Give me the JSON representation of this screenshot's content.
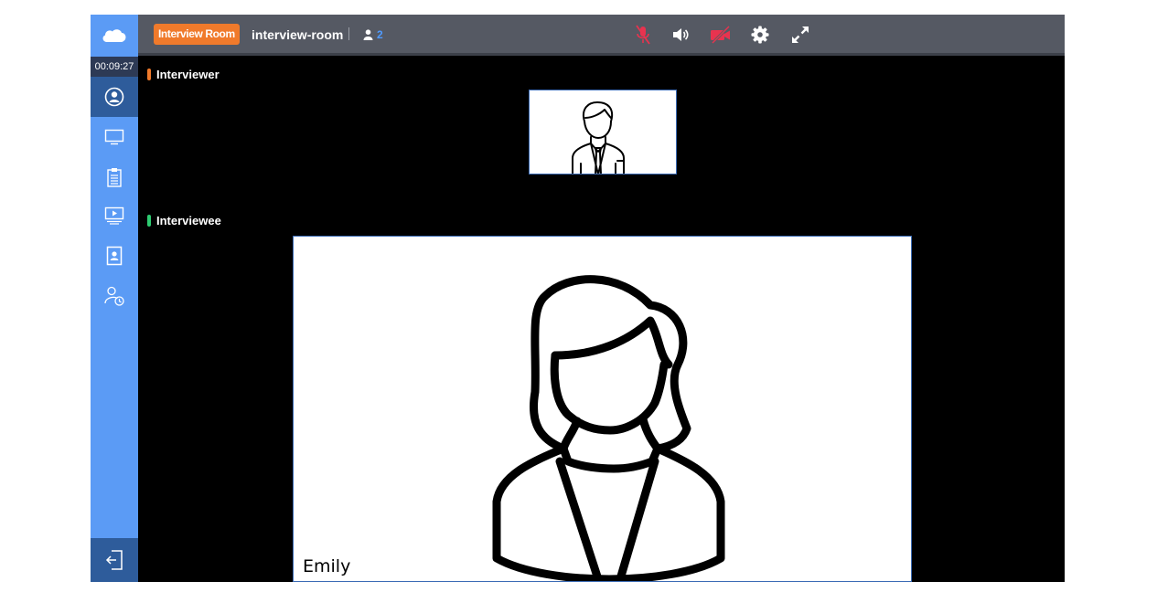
{
  "header": {
    "room_badge": "Interview Room",
    "room_name": "interview-room",
    "participant_count": "2",
    "controls": [
      {
        "icon": "mic-off-icon",
        "color": "#e8334f"
      },
      {
        "icon": "speaker-icon",
        "color": "#ffffff"
      },
      {
        "icon": "camera-off-icon",
        "color": "#e8334f"
      },
      {
        "icon": "gear-icon",
        "color": "#ffffff"
      },
      {
        "icon": "fullscreen-icon",
        "color": "#ffffff"
      }
    ]
  },
  "sidebar": {
    "timer": "00:09:27",
    "items": [
      {
        "icon": "user-circle-icon",
        "active": true
      },
      {
        "icon": "monitor-icon",
        "active": false
      },
      {
        "icon": "clipboard-icon",
        "active": false
      },
      {
        "icon": "screen-share-icon",
        "active": false
      },
      {
        "icon": "contact-card-icon",
        "active": false
      },
      {
        "icon": "user-clock-icon",
        "active": false
      }
    ],
    "exit_icon": "exit-icon"
  },
  "main": {
    "interviewer_label": "Interviewer",
    "interviewer_color": "#f07a2b",
    "interviewee_label": "Interviewee",
    "interviewee_color": "#2ecc71",
    "interviewee_name": "Emily"
  },
  "colors": {
    "sidebar": "#5b9bf5",
    "sidebar_active": "#2e5c9b",
    "header": "#555963",
    "accent_blue": "#4f9bff"
  }
}
